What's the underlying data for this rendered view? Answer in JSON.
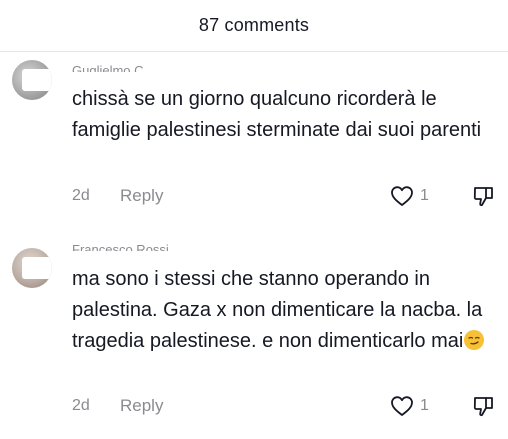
{
  "header": {
    "title": "87 comments"
  },
  "comments": [
    {
      "username": "Guglielmo C...",
      "text": "chissà se un giorno qualcuno ricorderà le famiglie palestinesi sterminate dai suoi parenti",
      "time": "2d",
      "reply_label": "Reply",
      "like_count": "1"
    },
    {
      "username": "Francesco Rossi",
      "text": "ma sono i stessi che stanno operando in palestina. Gaza x non dimenticare la nacba. la tragedia palestinese. e non dimenticarlo mai",
      "time": "2d",
      "reply_label": "Reply",
      "like_count": "1",
      "trailing_emoji": "smirking-face"
    }
  ],
  "colors": {
    "text": "#161823",
    "secondary": "#8a8b91",
    "divider": "#e6e6e6"
  }
}
